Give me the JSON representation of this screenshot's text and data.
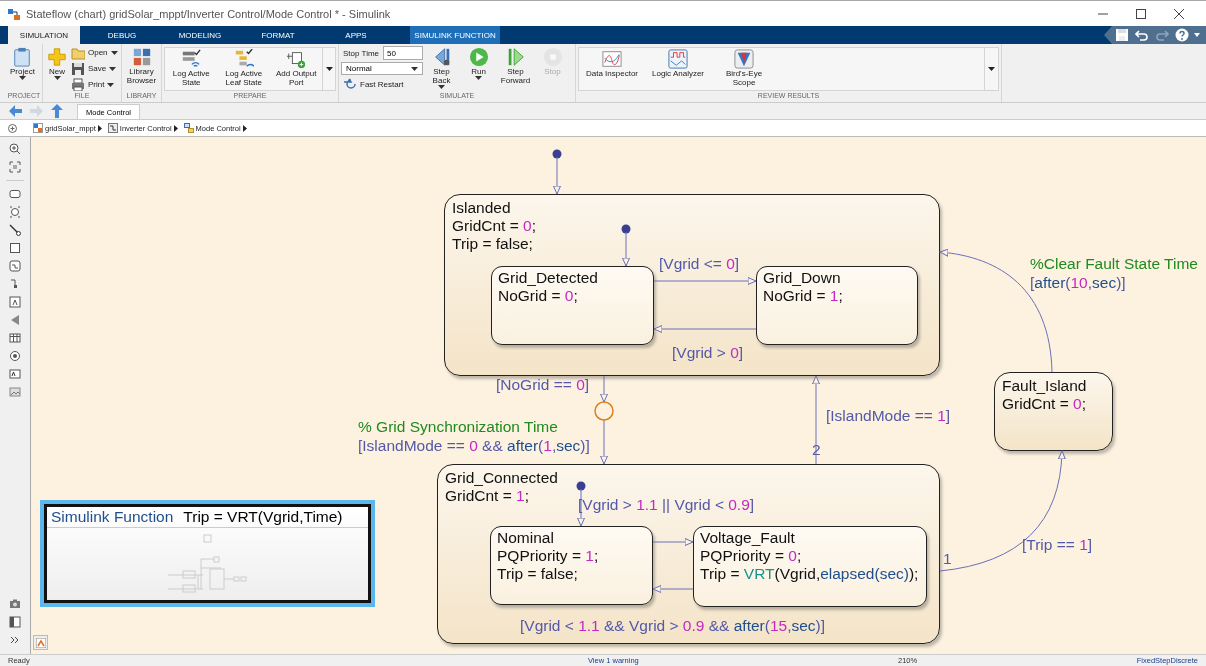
{
  "window": {
    "title": "Stateflow (chart) gridSolar_mppt/Inverter Control/Mode Control * - Simulink"
  },
  "ribbon_tabs": [
    {
      "label": "SIMULATION",
      "selected": true,
      "kind": "standard"
    },
    {
      "label": "DEBUG",
      "selected": false,
      "kind": "standard"
    },
    {
      "label": "MODELING",
      "selected": false,
      "kind": "standard"
    },
    {
      "label": "FORMAT",
      "selected": false,
      "kind": "standard"
    },
    {
      "label": "APPS",
      "selected": false,
      "kind": "standard"
    },
    {
      "label": "SIMULINK FUNCTION",
      "selected": false,
      "kind": "contextual"
    }
  ],
  "quick_access": [
    {
      "disabled": false
    },
    {
      "disabled": false
    },
    {
      "disabled": true
    },
    {
      "disabled": false
    }
  ],
  "ribbon_groups": [
    {
      "label": "PROJECT",
      "kind": "plain",
      "items": [
        {
          "kind": "large",
          "label": "Project",
          "menu": true,
          "disabled": false
        }
      ]
    },
    {
      "label": "FILE",
      "kind": "plain",
      "items": [
        {
          "kind": "large",
          "label": "New",
          "menu": true,
          "disabled": false
        },
        {
          "kind": "stack",
          "items": [
            {
              "kind": "small",
              "label": "Open",
              "menu": true
            },
            {
              "kind": "small",
              "label": "Save",
              "menu": true
            },
            {
              "kind": "small",
              "label": "Print",
              "menu": true
            }
          ]
        }
      ]
    },
    {
      "label": "LIBRARY",
      "kind": "plain",
      "items": [
        {
          "kind": "large",
          "label": "Library Browser",
          "menu": false,
          "disabled": false
        }
      ]
    },
    {
      "label": "PREPARE",
      "kind": "gallery",
      "items": [
        {
          "kind": "large",
          "label": "Log Active State",
          "menu": false,
          "disabled": false
        },
        {
          "kind": "large",
          "label": "Log Active Leaf State",
          "menu": false,
          "disabled": false
        },
        {
          "kind": "large",
          "label": "Add Output Port",
          "menu": false,
          "disabled": false
        },
        {
          "kind": "more"
        }
      ]
    },
    {
      "label": "SIMULATE",
      "kind": "plain",
      "items": [
        {
          "kind": "stack",
          "items": [
            {
              "kind": "field",
              "label": "Stop Time",
              "value": "50"
            },
            {
              "kind": "select",
              "value": "Normal"
            },
            {
              "kind": "small",
              "label": "Fast Restart",
              "menu": false
            }
          ]
        },
        {
          "kind": "large",
          "label": "Step Back",
          "menu": true,
          "disabled": false
        },
        {
          "kind": "large",
          "label": "Run",
          "menu": true,
          "disabled": false
        },
        {
          "kind": "large",
          "label": "Step Forward",
          "menu": false,
          "disabled": false
        },
        {
          "kind": "large",
          "label": "Stop",
          "menu": false,
          "disabled": true
        }
      ]
    },
    {
      "label": "REVIEW RESULTS",
      "kind": "gallery",
      "items": [
        {
          "kind": "large",
          "label": "Data Inspector",
          "menu": false,
          "disabled": false
        },
        {
          "kind": "large",
          "label": "Logic Analyzer",
          "menu": false,
          "disabled": false
        },
        {
          "kind": "large",
          "label": "Bird's-Eye Scope",
          "menu": false,
          "disabled": false
        },
        {
          "kind": "more"
        }
      ]
    }
  ],
  "nav_buttons": [
    {
      "disabled": false
    },
    {
      "disabled": true
    },
    {
      "disabled": false
    }
  ],
  "document_tabs": [
    {
      "label": "Mode Control",
      "selected": true
    }
  ],
  "breadcrumb": [
    {
      "label": "gridSolar_mppt"
    },
    {
      "label": "Inverter Control"
    },
    {
      "label": "Mode Control"
    }
  ],
  "states": [
    {
      "lines": [
        [
          {
            "text": "Islanded",
            "kind": "plain"
          }
        ],
        [
          {
            "text": "GridCnt = ",
            "kind": "plain"
          },
          {
            "text": "0",
            "kind": "number"
          },
          {
            "text": ";",
            "kind": "plain"
          }
        ],
        [
          {
            "text": "Trip = false;",
            "kind": "plain"
          }
        ]
      ],
      "children": [
        {
          "lines": [
            [
              {
                "text": "Grid_Detected",
                "kind": "plain"
              }
            ],
            [
              {
                "text": "NoGrid = ",
                "kind": "plain"
              },
              {
                "text": "0",
                "kind": "number"
              },
              {
                "text": ";",
                "kind": "plain"
              }
            ]
          ]
        },
        {
          "lines": [
            [
              {
                "text": "Grid_Down",
                "kind": "plain"
              }
            ],
            [
              {
                "text": "NoGrid = ",
                "kind": "plain"
              },
              {
                "text": "1",
                "kind": "number"
              },
              {
                "text": ";",
                "kind": "plain"
              }
            ]
          ]
        }
      ]
    },
    {
      "lines": [
        [
          {
            "text": "Grid_Connected",
            "kind": "plain"
          }
        ],
        [
          {
            "text": "GridCnt = ",
            "kind": "plain"
          },
          {
            "text": "1",
            "kind": "number"
          },
          {
            "text": ";",
            "kind": "plain"
          }
        ]
      ],
      "children": [
        {
          "lines": [
            [
              {
                "text": "Nominal",
                "kind": "plain"
              }
            ],
            [
              {
                "text": "PQPriority = ",
                "kind": "plain"
              },
              {
                "text": "1",
                "kind": "number"
              },
              {
                "text": ";",
                "kind": "plain"
              }
            ],
            [
              {
                "text": "Trip = false;",
                "kind": "plain"
              }
            ]
          ]
        },
        {
          "lines": [
            [
              {
                "text": "Voltage_Fault",
                "kind": "plain"
              }
            ],
            [
              {
                "text": "PQPriority = ",
                "kind": "plain"
              },
              {
                "text": "0",
                "kind": "number"
              },
              {
                "text": ";",
                "kind": "plain"
              }
            ],
            [
              {
                "text": "Trip = ",
                "kind": "plain"
              },
              {
                "text": "VRT",
                "kind": "function"
              },
              {
                "text": "(Vgrid,",
                "kind": "plain"
              },
              {
                "text": "elapsed(sec)",
                "kind": "keyword"
              },
              {
                "text": ");",
                "kind": "plain"
              }
            ]
          ]
        }
      ]
    },
    {
      "lines": [
        [
          {
            "text": "Fault_Island",
            "kind": "plain"
          }
        ],
        [
          {
            "text": "GridCnt = ",
            "kind": "plain"
          },
          {
            "text": "0",
            "kind": "number"
          },
          {
            "text": ";",
            "kind": "plain"
          }
        ]
      ]
    }
  ],
  "labels": [
    {
      "kind": "condition",
      "segments": [
        {
          "text": "[Vgrid <= ",
          "kind": "plain"
        },
        {
          "text": "0",
          "kind": "number"
        },
        {
          "text": "]",
          "kind": "plain"
        }
      ]
    },
    {
      "kind": "condition",
      "segments": [
        {
          "text": "[Vgrid > ",
          "kind": "plain"
        },
        {
          "text": "0",
          "kind": "number"
        },
        {
          "text": "]",
          "kind": "plain"
        }
      ]
    },
    {
      "kind": "comment",
      "segments": [
        {
          "text": "%Clear Fault State Time",
          "kind": "plain"
        }
      ]
    },
    {
      "kind": "condition",
      "segments": [
        {
          "text": "[",
          "kind": "plain"
        },
        {
          "text": "after",
          "kind": "keyword"
        },
        {
          "text": "(",
          "kind": "plain"
        },
        {
          "text": "10",
          "kind": "number"
        },
        {
          "text": ",",
          "kind": "plain"
        },
        {
          "text": "sec",
          "kind": "keyword"
        },
        {
          "text": ")]",
          "kind": "plain"
        }
      ]
    },
    {
      "kind": "condition",
      "segments": [
        {
          "text": "[NoGrid == ",
          "kind": "plain"
        },
        {
          "text": "0",
          "kind": "number"
        },
        {
          "text": "]",
          "kind": "plain"
        }
      ]
    },
    {
      "kind": "comment",
      "segments": [
        {
          "text": "% Grid Synchronization Time",
          "kind": "plain"
        }
      ]
    },
    {
      "kind": "condition",
      "segments": [
        {
          "text": "[IslandMode == ",
          "kind": "plain"
        },
        {
          "text": "0",
          "kind": "number"
        },
        {
          "text": " && ",
          "kind": "plain"
        },
        {
          "text": "after",
          "kind": "keyword"
        },
        {
          "text": "(",
          "kind": "plain"
        },
        {
          "text": "1",
          "kind": "number"
        },
        {
          "text": ",",
          "kind": "plain"
        },
        {
          "text": "sec",
          "kind": "keyword"
        },
        {
          "text": ")]",
          "kind": "plain"
        }
      ]
    },
    {
      "kind": "condition",
      "segments": [
        {
          "text": "[IslandMode == ",
          "kind": "plain"
        },
        {
          "text": "1",
          "kind": "number"
        },
        {
          "text": "]",
          "kind": "plain"
        }
      ]
    },
    {
      "kind": "order",
      "segments": [
        {
          "text": "2",
          "kind": "plain"
        }
      ]
    },
    {
      "kind": "condition",
      "segments": [
        {
          "text": "[Vgrid > ",
          "kind": "plain"
        },
        {
          "text": "1.1",
          "kind": "number"
        },
        {
          "text": " || Vgrid < ",
          "kind": "plain"
        },
        {
          "text": "0.9",
          "kind": "number"
        },
        {
          "text": "]",
          "kind": "plain"
        }
      ]
    },
    {
      "kind": "condition",
      "segments": [
        {
          "text": "[Trip == ",
          "kind": "plain"
        },
        {
          "text": "1",
          "kind": "number"
        },
        {
          "text": "]",
          "kind": "plain"
        }
      ]
    },
    {
      "kind": "order",
      "segments": [
        {
          "text": "1",
          "kind": "plain"
        }
      ]
    },
    {
      "kind": "condition",
      "segments": [
        {
          "text": "[Vgrid < ",
          "kind": "plain"
        },
        {
          "text": "1.1",
          "kind": "number"
        },
        {
          "text": " && Vgrid > ",
          "kind": "plain"
        },
        {
          "text": "0.9",
          "kind": "number"
        },
        {
          "text": " && ",
          "kind": "plain"
        },
        {
          "text": "after",
          "kind": "keyword"
        },
        {
          "text": "(",
          "kind": "plain"
        },
        {
          "text": "15",
          "kind": "number"
        },
        {
          "text": ",",
          "kind": "plain"
        },
        {
          "text": "sec",
          "kind": "keyword"
        },
        {
          "text": ")]",
          "kind": "plain"
        }
      ]
    }
  ],
  "simulink_function": {
    "kind_label": "Simulink Function",
    "signature": "Trip = VRT(Vgrid,Time)",
    "selected": true
  },
  "status_bar": {
    "message": "Ready",
    "warning_link": "View 1 warning",
    "zoom": "210%",
    "solver": "FixedStepDiscrete"
  }
}
